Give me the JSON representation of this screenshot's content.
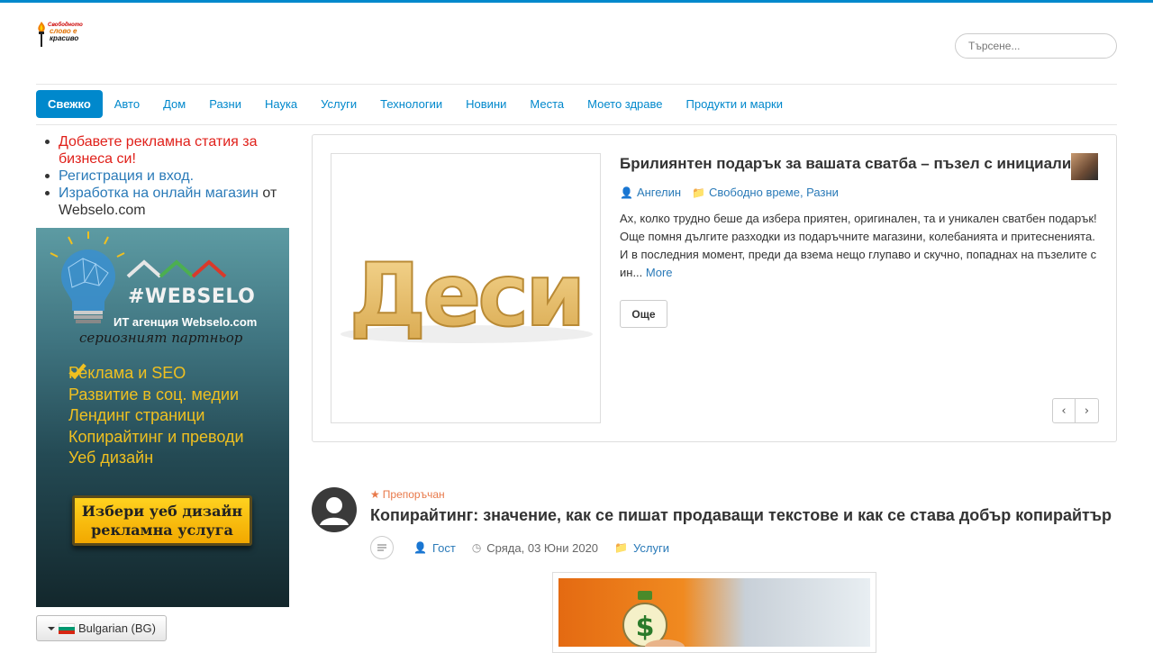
{
  "header": {
    "logo_lines": [
      "Свободното",
      "слово е",
      "красиво"
    ],
    "search_placeholder": "Търсене..."
  },
  "nav": {
    "items": [
      "Свежко",
      "Авто",
      "Дом",
      "Разни",
      "Наука",
      "Услуги",
      "Технологии",
      "Новини",
      "Места",
      "Моето здраве",
      "Продукти и марки"
    ],
    "active": "Свежко"
  },
  "sidebar": {
    "links": [
      {
        "text": "Добавете рекламна статия за бизнеса си!"
      },
      {
        "text": "Регистрация и вход."
      },
      {
        "text": "Изработка на онлайн магазин",
        "suffix": " от Webselo.com"
      }
    ],
    "banner": {
      "hashtag": "#WEBSELO",
      "agency": "ИТ агенция Webselo.com",
      "tagline": "сериозният партньор",
      "services": [
        "Реклама и SEO",
        "Развитие в соц. медии",
        "Лендинг страници",
        "Копирайтинг и преводи",
        "Уеб дизайн"
      ],
      "cta_line1": "Избери уеб дизайн",
      "cta_line2": "рекламна услуга"
    },
    "language": "Bulgarian (BG)"
  },
  "slider": {
    "image_word": "Деси",
    "title": "Брилиянтен подарък за вашата сватба – пъзел с инициали",
    "author": "Ангелин",
    "categories": "Свободно време, Разни",
    "text": "Ах, колко трудно беше да избера приятен, оригинален, та и уникален сватбен подарък! Още помня дългите разходки из подаръчните магазини, колебанията и притесненията. И в последния момент, преди да взема нещо глупаво и скучно, попаднах на пъзелите с ин...",
    "more_link": "More",
    "button": "Още",
    "prev": "‹",
    "next": "›"
  },
  "article": {
    "badge": "Препоръчан",
    "title": "Копирайтинг: значение, как се пишат продаващи текстове и как се става добър копирайтър",
    "author": "Гост",
    "date": "Сряда, 03 Юни 2020",
    "category": "Услуги"
  },
  "colors": {
    "accent": "#0088cc",
    "link": "#2a7ab8",
    "red_link": "#e0201a",
    "featured": "#e8794a",
    "banner_text": "#f0c020"
  }
}
